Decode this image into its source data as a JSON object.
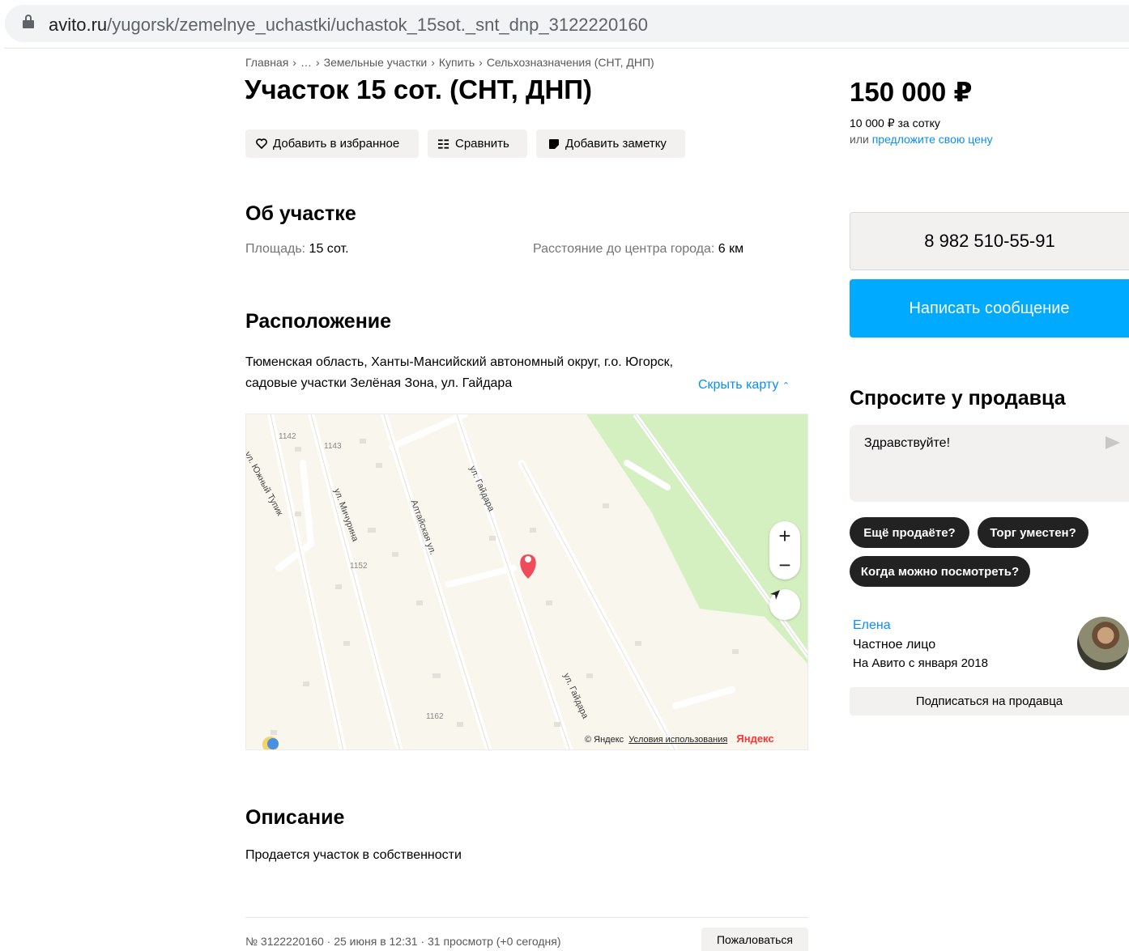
{
  "browser": {
    "url_host": "avito.ru",
    "url_path": "/yugorsk/zemelnye_uchastki/uchastok_15sot._snt_dnp_3122220160"
  },
  "breadcrumb": [
    "Главная",
    "…",
    "Земельные участки",
    "Купить",
    "Сельхозназначения (СНТ, ДНП)"
  ],
  "listing": {
    "title": "Участок 15 сот. (СНТ, ДНП)",
    "actions": {
      "favorite": "Добавить в избранное",
      "compare": "Сравнить",
      "note": "Добавить заметку"
    }
  },
  "about": {
    "heading": "Об участке",
    "area_label": "Площадь:",
    "area_value": "15 сот.",
    "distance_label": "Расстояние до центра города:",
    "distance_value": "6 км"
  },
  "location": {
    "heading": "Расположение",
    "address": "Тюменская область, Ханты-Мансийский автономный округ, г.о. Югорск, садовые участки Зелёная Зона, ул. Гайдара",
    "hide_map": "Скрыть карту",
    "map": {
      "streets": [
        "ул. Южный Тупик",
        "ул. Мичурина",
        "Алтайская ул.",
        "ул. Гайдара",
        "ул. Гайдара"
      ],
      "numbers": [
        "1142",
        "1143",
        "1152",
        "1162"
      ],
      "copyright": "© Яндекс",
      "terms": "Условия использования",
      "logo": "Яндекс",
      "zoom_in": "+",
      "zoom_out": "−"
    }
  },
  "description": {
    "heading": "Описание",
    "text": "Продается участок в собственности"
  },
  "footer": {
    "meta": "№ 3122220160 · 25 июня в 12:31 · 31 просмотр (+0 сегодня)",
    "report": "Пожаловаться"
  },
  "sidebar": {
    "price": "150 000 ₽",
    "price_per": "10 000 ₽ за сотку",
    "offer_prefix": "или",
    "offer_link": "предложите свою цену",
    "phone": "8 982 510-55-91",
    "message": "Написать сообщение",
    "ask_title": "Спросите у продавца",
    "ask_placeholder": "Здравствуйте!",
    "quick_questions": [
      "Ещё продаёте?",
      "Торг уместен?",
      "Когда можно посмотреть?"
    ],
    "seller": {
      "name": "Елена",
      "type": "Частное лицо",
      "since": "На Авито с января 2018",
      "subscribe": "Подписаться на продавца"
    }
  },
  "colors": {
    "accent_blue": "#00aaff",
    "link_blue": "#0a8ef5",
    "map_pin": "#ef4b5a",
    "map_green": "#d4f0c0"
  }
}
